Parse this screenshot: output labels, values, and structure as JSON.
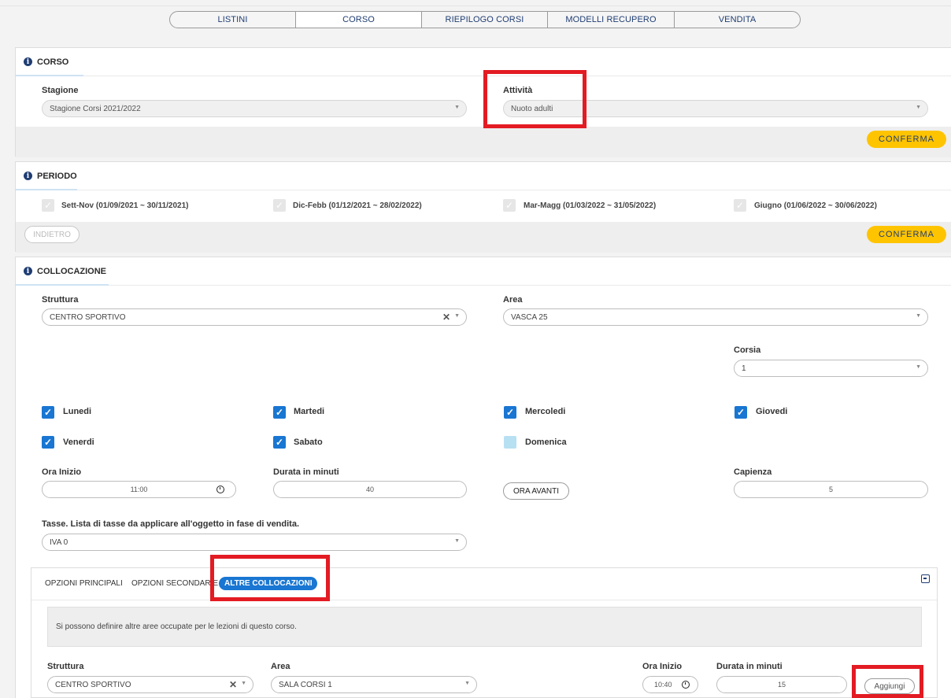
{
  "top_tabs": [
    {
      "label": "LISTINI"
    },
    {
      "label": "CORSO"
    },
    {
      "label": "RIEPILOGO CORSI"
    },
    {
      "label": "MODELLI RECUPERO"
    },
    {
      "label": "VENDITA"
    }
  ],
  "corso": {
    "title": "CORSO",
    "stagione_label": "Stagione",
    "stagione_value": "Stagione Corsi 2021/2022",
    "attivita_label": "Attività",
    "attivita_value": "Nuoto adulti",
    "confirm": "CONFERMA"
  },
  "periodo": {
    "title": "PERIODO",
    "periods": [
      {
        "label": "Sett-Nov (01/09/2021 ~ 30/11/2021)"
      },
      {
        "label": "Dic-Febb (01/12/2021 ~ 28/02/2022)"
      },
      {
        "label": "Mar-Magg (01/03/2022 ~ 31/05/2022)"
      },
      {
        "label": "Giugno (01/06/2022 ~ 30/06/2022)"
      }
    ],
    "back": "INDIETRO",
    "confirm": "CONFERMA"
  },
  "collocazione": {
    "title": "COLLOCAZIONE",
    "struttura_label": "Struttura",
    "struttura_value": "CENTRO SPORTIVO",
    "area_label": "Area",
    "area_value": "VASCA 25",
    "corsia_label": "Corsia",
    "corsia_value": "1",
    "days": [
      {
        "label": "Lunedi",
        "checked": true
      },
      {
        "label": "Martedi",
        "checked": true
      },
      {
        "label": "Mercoledi",
        "checked": true
      },
      {
        "label": "Giovedi",
        "checked": true
      },
      {
        "label": "Venerdi",
        "checked": true
      },
      {
        "label": "Sabato",
        "checked": true
      },
      {
        "label": "Domenica",
        "checked": false
      }
    ],
    "ora_inizio_label": "Ora Inizio",
    "ora_inizio_value": "11:00",
    "durata_label": "Durata in minuti",
    "durata_value": "40",
    "ora_avanti": "ORA AVANTI",
    "capienza_label": "Capienza",
    "capienza_value": "5",
    "tasse_label": "Tasse. Lista di tasse da applicare all'oggetto in fase di vendita.",
    "tasse_value": "IVA 0"
  },
  "inner": {
    "tabs": [
      {
        "label": "OPZIONI PRINCIPALI"
      },
      {
        "label": "OPZIONI SECONDARIE"
      },
      {
        "label": "ALTRE COLLOCAZIONI"
      }
    ],
    "notice": "Si possono definire altre aree occupate per le lezioni di questo corso.",
    "struttura_label": "Struttura",
    "struttura_value": "CENTRO SPORTIVO",
    "area_label": "Area",
    "area_value": "SALA CORSI 1",
    "ora_inizio_label": "Ora Inizio",
    "ora_inizio_value": "10:40",
    "durata_label": "Durata in minuti",
    "durata_value": "15",
    "add": "Aggiungi"
  },
  "colors": {
    "accent_yellow": "#ffc400",
    "accent_blue": "#1976d2",
    "navy": "#1f3d73",
    "highlight_red": "#e31b23"
  }
}
